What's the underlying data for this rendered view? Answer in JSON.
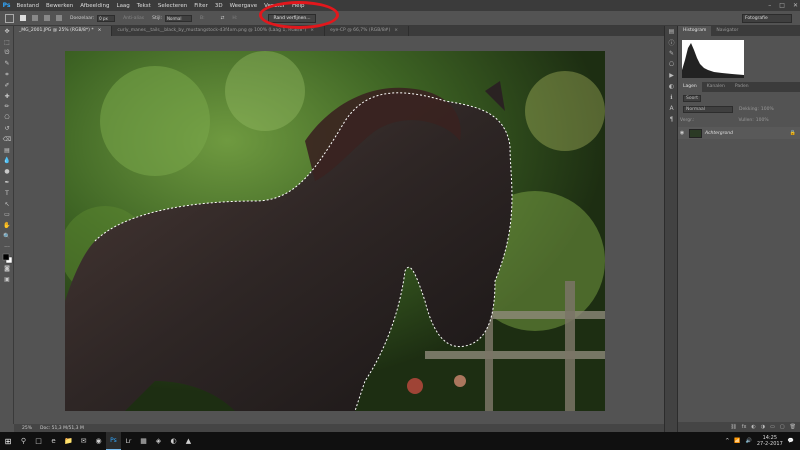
{
  "menubar": {
    "logo": "Ps",
    "items": [
      "Bestand",
      "Bewerken",
      "Afbeelding",
      "Laag",
      "Tekst",
      "Selecteren",
      "Filter",
      "3D",
      "Weergave",
      "Venster",
      "Help"
    ],
    "window_controls": [
      "–",
      "□",
      "✕"
    ]
  },
  "options": {
    "feather_label": "Doezelaar:",
    "feather_value": "0 px",
    "antialias_label": "Anti-alias",
    "style_label": "Stijl:",
    "style_value": "Normal",
    "width_label": "B:",
    "height_label": "H:",
    "refine_edge": "Rand verfijnen...",
    "workspace": "Fotografie",
    "highlight_color": "#e2171c"
  },
  "tabs": [
    {
      "label": "_MG_2001.JPG @ 25% (RGB/8*) *",
      "close": "×",
      "active": true
    },
    {
      "label": "curly_manes__tails__black_by_mustangstock-d3f4xm.png @ 100% (Laag 1, RGB/8*)",
      "close": "×",
      "active": false
    },
    {
      "label": "eye-CP @ 66,7% (RGB/8#)",
      "close": "×",
      "active": false
    }
  ],
  "toolbar": {
    "icons": [
      "move-icon",
      "marquee-icon",
      "lasso-icon",
      "quick-select-icon",
      "crop-icon",
      "eyedropper-icon",
      "healing-icon",
      "brush-icon",
      "clone-stamp-icon",
      "history-brush-icon",
      "eraser-icon",
      "gradient-icon",
      "blur-icon",
      "dodge-icon",
      "pen-icon",
      "type-icon",
      "path-select-icon",
      "shape-icon",
      "hand-icon",
      "zoom-icon",
      "more-icon",
      "color-swatches-icon",
      "quick-mask-icon",
      "screen-mode-icon"
    ],
    "glyphs": [
      "✥",
      "⬚",
      "ᘎ",
      "✎",
      "⌗",
      "✐",
      "✚",
      "✏",
      "⎔",
      "↺",
      "⌫",
      "▤",
      "💧",
      "●",
      "✒",
      "T",
      "↖",
      "▭",
      "✋",
      "🔍",
      "···",
      "◧",
      "◙",
      "▣"
    ]
  },
  "status": {
    "zoom": "25%",
    "doc": "Doc: 51,3 M/51,3 M"
  },
  "panels": {
    "top_tabs": [
      "Histogram",
      "Navigator"
    ],
    "layer_tabs": [
      "Lagen",
      "Kanalen",
      "Paden"
    ],
    "kind_filter": "Soort",
    "blend_mode": "Normaal",
    "opacity_label": "Dekking:",
    "opacity_value": "100%",
    "lock_label": "Vergr.:",
    "fill_label": "Vullen:",
    "fill_value": "100%",
    "layer_name": "Achtergrond",
    "footer_icons": [
      "⛓",
      "fx",
      "◐",
      "◑",
      "▭",
      "▢",
      "🗑"
    ]
  },
  "taskbar": {
    "apps": [
      "□",
      "e",
      "📁",
      "✉",
      "◉",
      "Ps",
      "Lr",
      "▦",
      "◈",
      "◐",
      "▲"
    ],
    "time": "14:25",
    "date": "27-2-2017",
    "tray": [
      "^",
      "📶",
      "🔊",
      "💬"
    ]
  }
}
